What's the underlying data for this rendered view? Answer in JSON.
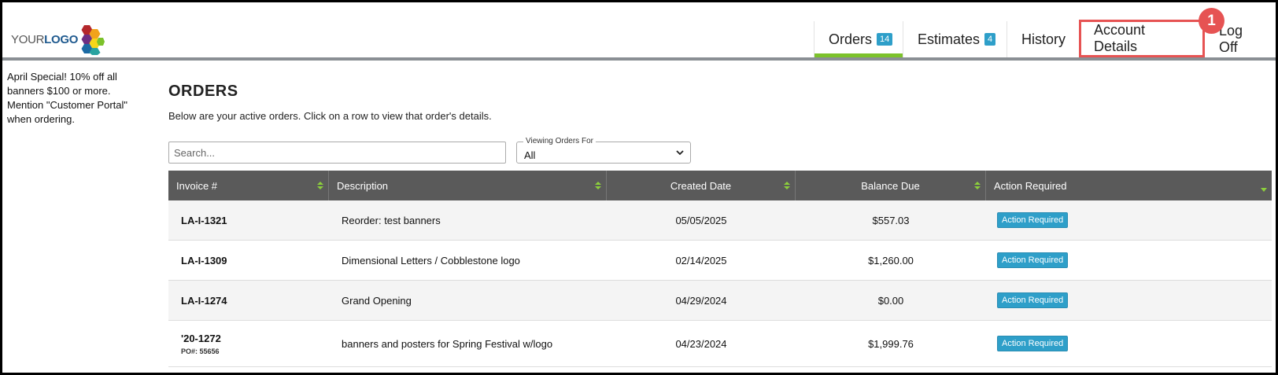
{
  "logo": {
    "text_light": "YOUR",
    "text_bold": "LOGO"
  },
  "nav": {
    "orders": {
      "label": "Orders",
      "badge": "14"
    },
    "estimates": {
      "label": "Estimates",
      "badge": "4"
    },
    "history": {
      "label": "History"
    },
    "account": {
      "label": "Account Details"
    },
    "logoff": {
      "label": "Log Off"
    }
  },
  "callout": "1",
  "sidebar": {
    "message": "April Special! 10% off all banners $100 or more. Mention \"Customer Portal\" when ordering."
  },
  "page": {
    "title": "ORDERS",
    "description": "Below are your active orders. Click on a row to view that order's details."
  },
  "search": {
    "placeholder": "Search..."
  },
  "filter": {
    "label": "Viewing Orders For",
    "value": "All"
  },
  "table": {
    "headers": {
      "invoice": "Invoice #",
      "description": "Description",
      "created": "Created Date",
      "balance": "Balance Due",
      "action": "Action Required"
    },
    "rows": [
      {
        "invoice": "LA-I-1321",
        "po": "",
        "description": "Reorder: test banners",
        "created": "05/05/2025",
        "balance": "$557.03",
        "action": "Action Required"
      },
      {
        "invoice": "LA-I-1309",
        "po": "",
        "description": "Dimensional Letters / Cobblestone logo",
        "created": "02/14/2025",
        "balance": "$1,260.00",
        "action": "Action Required"
      },
      {
        "invoice": "LA-I-1274",
        "po": "",
        "description": "Grand Opening",
        "created": "04/29/2024",
        "balance": "$0.00",
        "action": "Action Required"
      },
      {
        "invoice": "'20-1272",
        "po": "PO#: 55656",
        "description": "banners and posters for Spring Festival w/logo",
        "created": "04/23/2024",
        "balance": "$1,999.76",
        "action": "Action Required"
      }
    ]
  },
  "colors": {
    "accent_green": "#7cc22b",
    "badge_blue": "#2e9fc9",
    "callout_red": "#e65353",
    "table_header": "#5a5a5a"
  }
}
